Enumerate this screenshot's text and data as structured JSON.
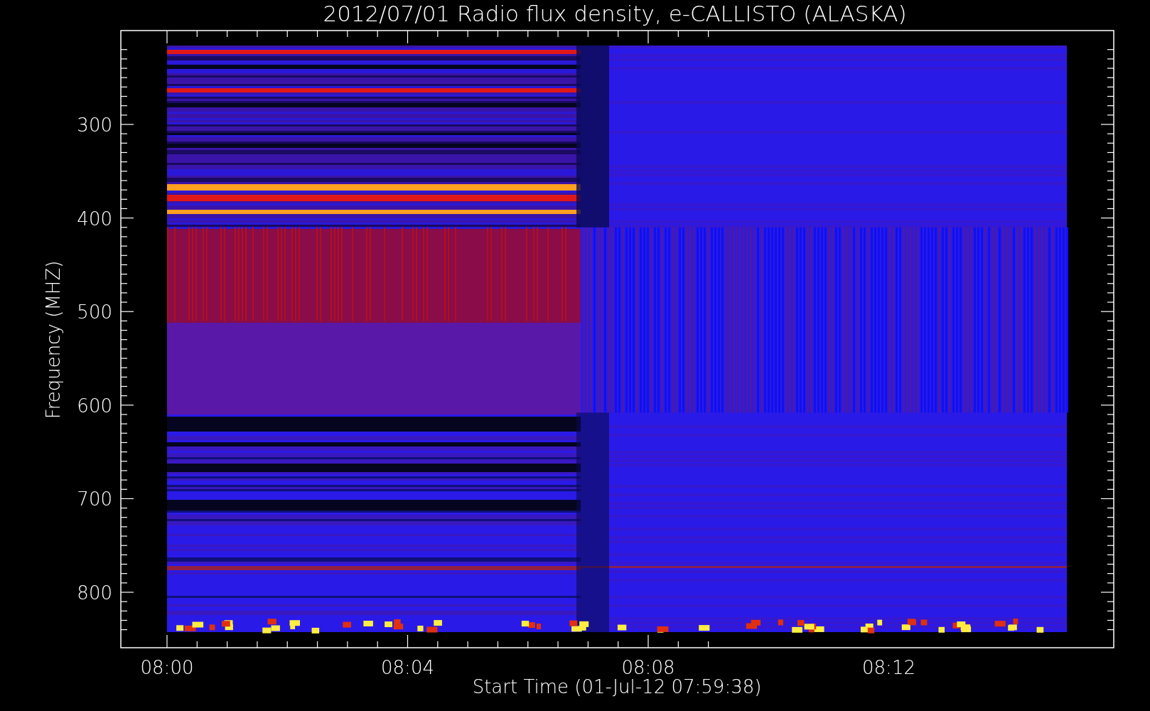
{
  "title": "2012/07/01  Radio flux density, e-CALLISTO (ALASKA)",
  "y_axis": {
    "label": "Frequency (MHZ)",
    "ticks": [
      "300",
      "400",
      "500",
      "600",
      "700",
      "800"
    ]
  },
  "x_axis": {
    "label": "Start Time (01-Jul-12 07:59:38)",
    "ticks": [
      "08:00",
      "08:04",
      "08:08",
      "08:12"
    ]
  }
}
